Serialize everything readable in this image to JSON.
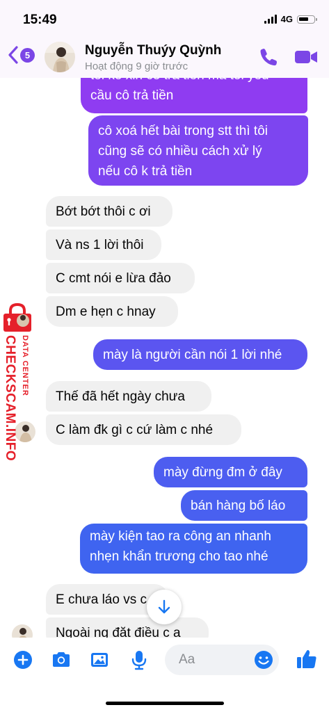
{
  "status_bar": {
    "time": "15:49",
    "network": "4G"
  },
  "header": {
    "unread_count": "5",
    "contact_name": "Nguyễn Thuýy Quỳnh",
    "activity_status": "Hoạt động 9 giờ trước"
  },
  "messages": [
    {
      "direction": "outgoing",
      "text": "tôi ko xin cô trả tiền mà tôi yêu\ncầu cô trả tiền"
    },
    {
      "direction": "outgoing",
      "text": "cô xoá hết bài trong stt thì tôi\ncũng sẽ có nhiều cách xử lý\nnếu cô k trả tiền"
    },
    {
      "direction": "incoming",
      "text": "Bớt bớt thôi c ơi"
    },
    {
      "direction": "incoming",
      "text": "Và ns 1 lời thôi"
    },
    {
      "direction": "incoming",
      "text": "C cmt nói e lừa đảo"
    },
    {
      "direction": "incoming",
      "text": "Dm e hẹn c hnay"
    },
    {
      "direction": "outgoing",
      "text": "mày là người cần nói 1 lời nhé"
    },
    {
      "direction": "incoming",
      "text": "Thế đã hết ngày chưa"
    },
    {
      "direction": "incoming",
      "text": "C làm đk gì c cứ làm c nhé"
    },
    {
      "direction": "outgoing",
      "text": "mày đừng đm ở đây"
    },
    {
      "direction": "outgoing",
      "text": "bán hàng bố láo"
    },
    {
      "direction": "outgoing",
      "text": "mày kiện tao ra công an nhanh\nnhẹn khẩn trương cho tao nhé"
    },
    {
      "direction": "incoming",
      "text": "E chưa láo vs c"
    },
    {
      "direction": "incoming",
      "text": "Ngoài ng đặt điều c a"
    }
  ],
  "composer": {
    "placeholder": "Aa",
    "icons": [
      "plus-circle-icon",
      "camera-icon",
      "image-icon",
      "microphone-icon",
      "emoji-icon",
      "thumbs-up-icon"
    ]
  },
  "watermark": {
    "brand": "CHECKSCAM.INFO",
    "tagline": "DATA CENTER"
  },
  "colors": {
    "accent": "#7b46e6",
    "bubble_out_top": "#8e3bf0",
    "bubble_out_bottom": "#3e64f0",
    "bubble_in": "#f0f0f0",
    "composer_icons": "#1877f2",
    "watermark_red": "#e5202a"
  }
}
